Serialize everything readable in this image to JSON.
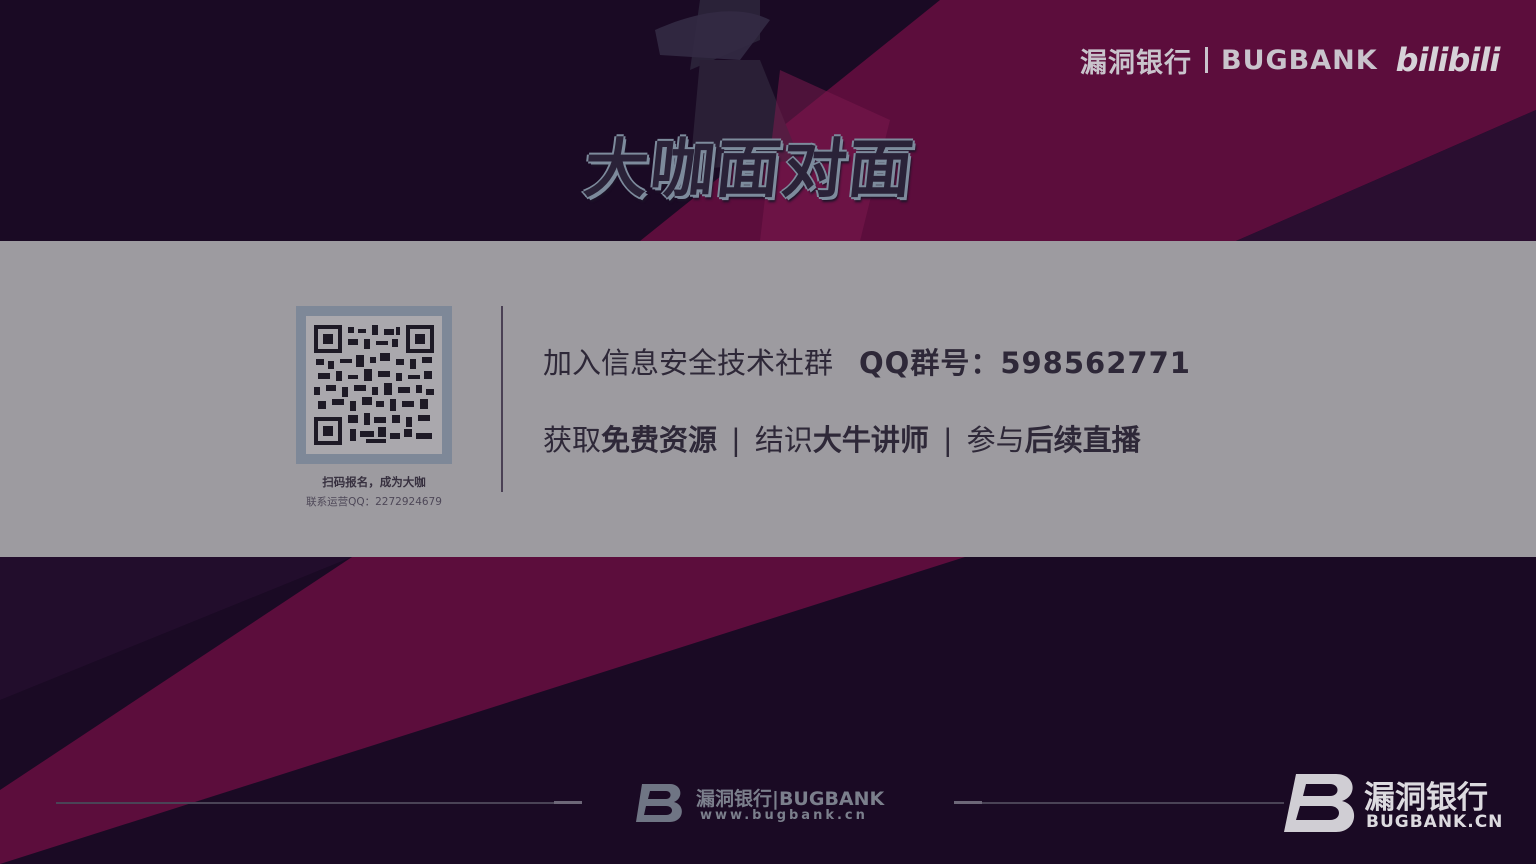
{
  "header": {
    "brand_cn": "漏洞银行",
    "brand_en": "BUGBANK",
    "partner_logo": "bilibili",
    "show_title": "大咖面对面"
  },
  "qr_panel": {
    "caption": "扫码报名，成为大咖",
    "contact": "联系运营QQ：2272924679"
  },
  "info": {
    "join_text": "加入信息安全技术社群",
    "qq_group": "QQ群号：598562771",
    "benefits": [
      {
        "prefix": "获取",
        "highlight": "免费资源"
      },
      {
        "prefix": "结识",
        "highlight": "大牛讲师"
      },
      {
        "prefix": "参与",
        "highlight": "后续直播"
      }
    ],
    "separator": "|"
  },
  "footer": {
    "brand": "漏洞银行|BUGBANK",
    "url": "www.bugbank.cn"
  },
  "corner_logo": {
    "name_cn": "漏洞银行",
    "domain": "BUGBANK.CN"
  },
  "colors": {
    "background": "#1a0a24",
    "stripe": "#5c0d3c",
    "band": "#9d9ba0",
    "text_dark": "#2e2838"
  },
  "icons": [
    "qr-code-icon",
    "bugbank-b-logo-icon"
  ]
}
